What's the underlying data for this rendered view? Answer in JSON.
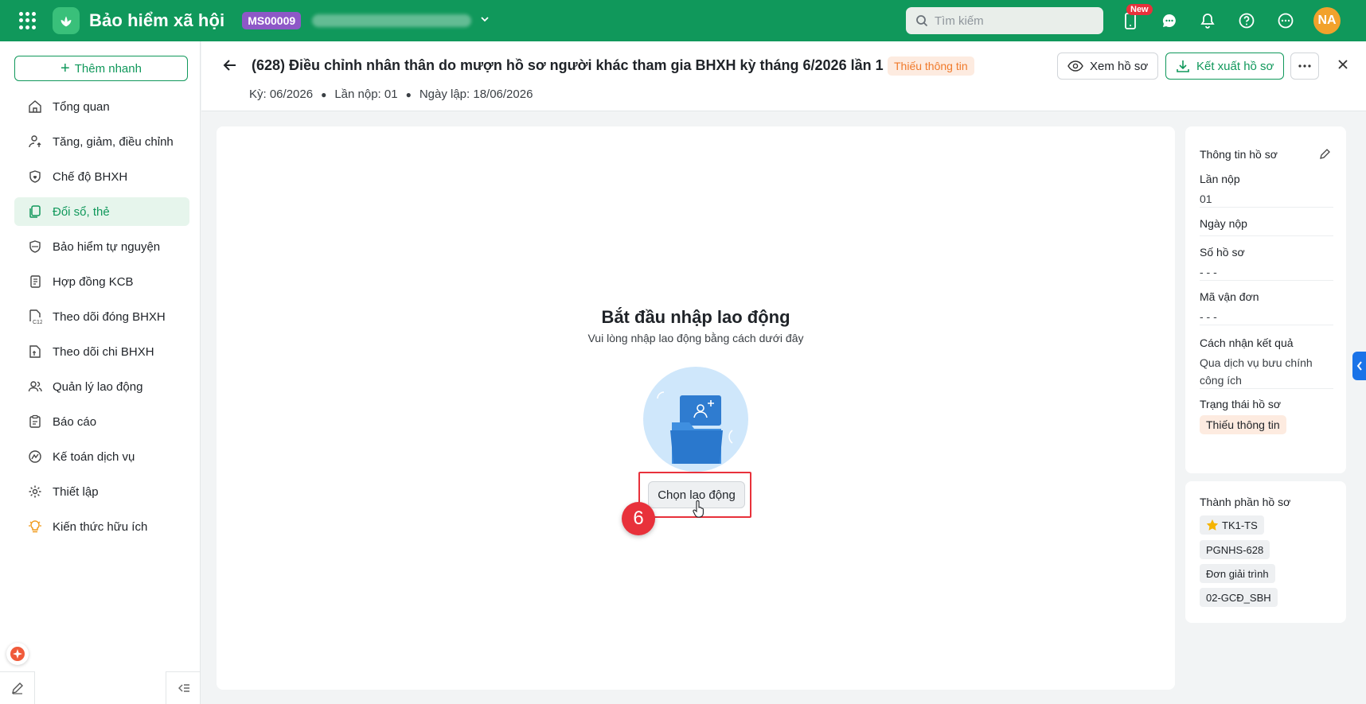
{
  "topbar": {
    "app_title": "Bảo hiểm xã hội",
    "ms_code": "MS00009",
    "search_placeholder": "Tìm kiếm",
    "new_badge": "New",
    "avatar_initials": "NA",
    "brand_color": "#10985b"
  },
  "sidebar": {
    "add_label": "Thêm nhanh",
    "items": [
      {
        "label": "Tổng quan",
        "icon": "home-icon"
      },
      {
        "label": "Tăng, giảm, điều chỉnh",
        "icon": "user-up-icon"
      },
      {
        "label": "Chế độ BHXH",
        "icon": "shield-heart-icon"
      },
      {
        "label": "Đổi sổ, thẻ",
        "icon": "copy-doc-icon",
        "active": true
      },
      {
        "label": "Bảo hiểm tự nguyện",
        "icon": "shield-icon"
      },
      {
        "label": "Hợp đồng KCB",
        "icon": "contract-icon"
      },
      {
        "label": "Theo dõi đóng BHXH",
        "icon": "doc-c12-icon"
      },
      {
        "label": "Theo dõi chi BHXH",
        "icon": "doc-money-icon"
      },
      {
        "label": "Quản lý lao động",
        "icon": "users-icon"
      },
      {
        "label": "Báo cáo",
        "icon": "clipboard-icon"
      },
      {
        "label": "Kế toán dịch vụ",
        "icon": "accounting-icon"
      },
      {
        "label": "Thiết lập",
        "icon": "gear-icon"
      },
      {
        "label": "Kiến thức hữu ích",
        "icon": "lightbulb-icon"
      }
    ]
  },
  "header": {
    "title": "(628) Điều chỉnh nhân thân do mượn hồ sơ người khác tham gia BHXH kỳ tháng 6/2026 lần 1",
    "status": "Thiếu thông tin",
    "period": "Kỳ: 06/2026",
    "submission": "Lần nộp: 01",
    "created": "Ngày lập: 18/06/2026",
    "view_label": "Xem hồ sơ",
    "export_label": "Kết xuất hồ sơ"
  },
  "main": {
    "empty_title": "Bắt đầu nhập lao động",
    "empty_subtitle": "Vui lòng nhập lao động bằng cách dưới đây",
    "choose_label": "Chọn lao động",
    "step_number": "6"
  },
  "info_panel": {
    "title": "Thông tin hồ sơ",
    "rows": [
      {
        "label": "Lần nộp",
        "value": "01"
      },
      {
        "label": "Ngày nộp",
        "value": ""
      },
      {
        "label": "Số hồ sơ",
        "value": "- - -"
      },
      {
        "label": "Mã vận đơn",
        "value": "- - -"
      },
      {
        "label": "Cách nhận kết quả",
        "value": "Qua dịch vụ bưu chính công ích"
      },
      {
        "label": "Trạng thái hồ sơ",
        "value": "Thiếu thông tin"
      }
    ]
  },
  "parts_panel": {
    "title": "Thành phần hồ sơ",
    "chips": [
      "TK1-TS",
      "PGNHS-628",
      "Đơn giải trình",
      "02-GCĐ_SBH"
    ]
  }
}
